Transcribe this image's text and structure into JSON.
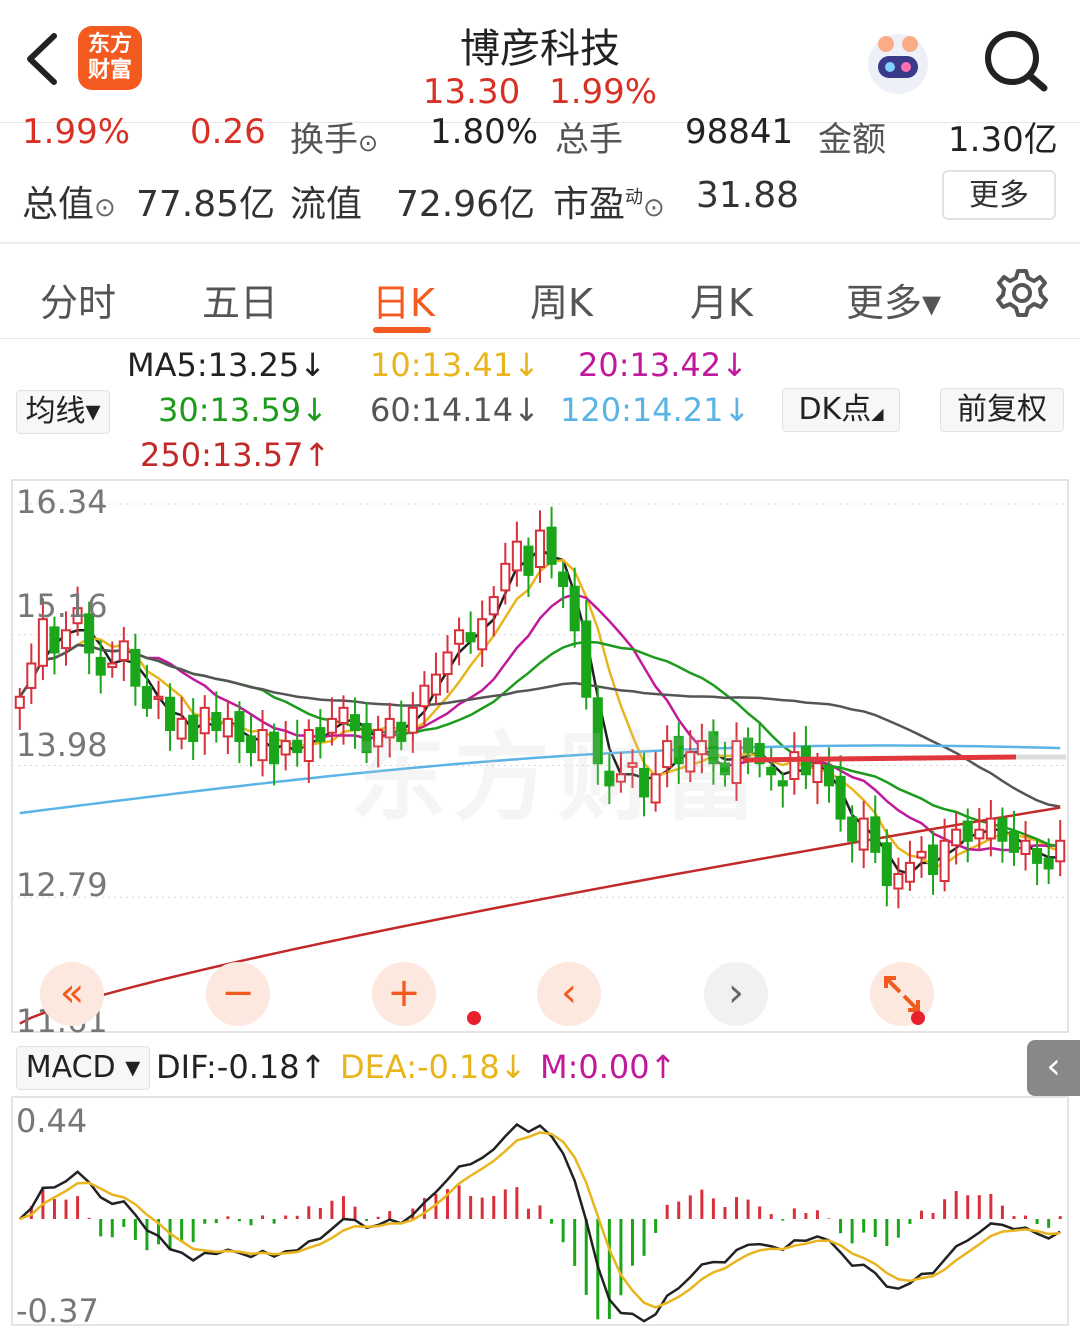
{
  "header": {
    "logo_line1": "东方",
    "logo_line2": "财富",
    "stock_name": "博彦科技",
    "price": "13.30",
    "change_pct": "1.99%"
  },
  "quote": {
    "change_pct": "1.99%",
    "change_amt": "0.26",
    "turnover_label": "换手",
    "turnover_value": "1.80%",
    "volume_label": "总手",
    "volume_value": "98841",
    "amount_label": "金额",
    "amount_value": "1.30亿",
    "total_mv_label": "总值",
    "total_mv_value": "77.85亿",
    "float_mv_label": "流值",
    "float_mv_value": "72.96亿",
    "pe_label": "市盈",
    "pe_sup": "动",
    "pe_value": "31.88",
    "more_label": "更多"
  },
  "tabs": [
    {
      "label": "分时"
    },
    {
      "label": "五日"
    },
    {
      "label": "日K",
      "active": true
    },
    {
      "label": "周K"
    },
    {
      "label": "月K"
    },
    {
      "label": "更多▾"
    }
  ],
  "ma_legend": {
    "selector": "均线▾",
    "ma5": "MA5:13.25↓",
    "ma10": "10:13.41↓",
    "ma20": "20:13.42↓",
    "ma30": "30:13.59↓",
    "ma60": "60:14.14↓",
    "ma120": "120:14.21↓",
    "ma250": "250:13.57↑",
    "dk_button": "DK点",
    "adjust_button": "前复权",
    "colors": {
      "ma5": "#222222",
      "ma10": "#e8b51e",
      "ma20": "#c01a9b",
      "ma30": "#1c9b1c",
      "ma60": "#555555",
      "ma120": "#5ab4e6",
      "ma250": "#c22a2a"
    }
  },
  "price_axis": {
    "high": "16.34",
    "mid1": "15.16",
    "mid2": "13.98",
    "low1": "12.79",
    "low2": "11.61"
  },
  "chart_controls": [
    "«",
    "−",
    "+",
    "‹",
    "›"
  ],
  "macd": {
    "selector": "MACD ▾",
    "dif": "DIF:-0.18↑",
    "dea": "DEA:-0.18↓",
    "m": "M:0.00↑",
    "axis_high": "0.44",
    "axis_low": "-0.37",
    "collapse": "‹"
  },
  "watermark": "东方财富",
  "chart_data": {
    "type": "candlestick",
    "ylim": [
      11.61,
      16.34
    ],
    "closes": [
      14.6,
      14.9,
      15.3,
      15.0,
      15.2,
      15.4,
      15.0,
      14.8,
      14.9,
      15.1,
      14.7,
      14.5,
      14.6,
      14.3,
      14.4,
      14.2,
      14.5,
      14.3,
      14.4,
      14.2,
      14.1,
      14.3,
      14.0,
      14.2,
      14.1,
      14.3,
      14.2,
      14.4,
      14.5,
      14.3,
      14.1,
      14.3,
      14.4,
      14.2,
      14.5,
      14.7,
      14.8,
      15.0,
      15.2,
      15.1,
      15.3,
      15.5,
      15.8,
      16.0,
      15.7,
      16.1,
      15.8,
      15.6,
      15.2,
      14.6,
      14.0,
      13.8,
      13.9,
      14.0,
      13.7,
      13.9,
      14.2,
      14.0,
      14.1,
      14.2,
      14.0,
      13.9,
      14.2,
      14.1,
      14.0,
      13.9,
      13.8,
      14.1,
      13.9,
      14.0,
      13.8,
      13.5,
      13.3,
      13.5,
      13.2,
      12.9,
      13.0,
      13.1,
      13.2,
      13.0,
      13.3,
      13.4,
      13.3,
      13.4,
      13.5,
      13.3,
      13.2,
      13.3,
      13.1,
      13.05,
      13.3
    ],
    "ma_values": {
      "MA5": 13.25,
      "MA10": 13.41,
      "MA20": 13.42,
      "MA30": 13.59,
      "MA60": 14.14,
      "MA120": 14.21,
      "MA250": 13.57
    }
  }
}
